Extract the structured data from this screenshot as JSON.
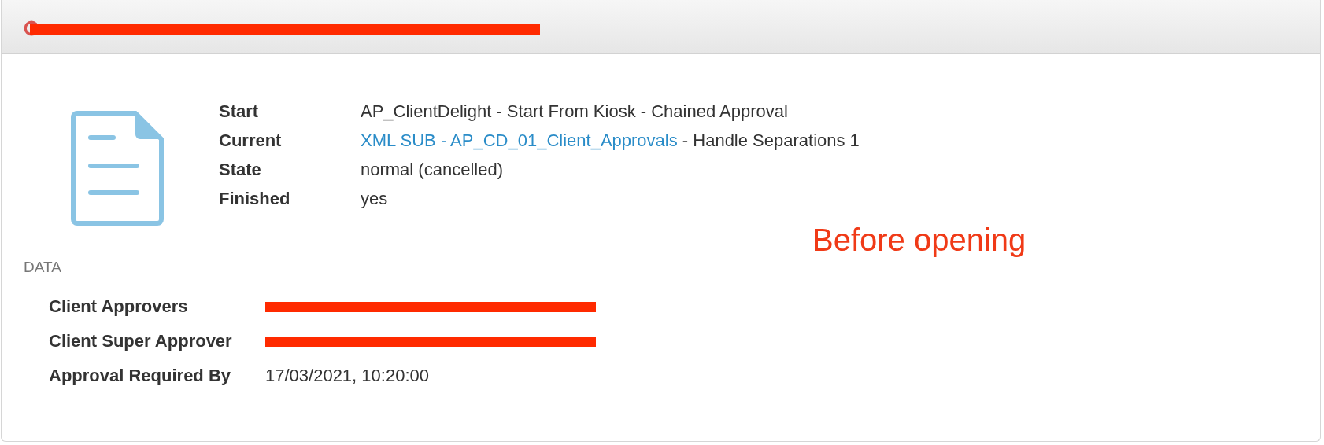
{
  "header": {
    "cancelled": true,
    "title_redacted": true
  },
  "summary": [
    {
      "label": "Start",
      "parts": [
        {
          "text": "AP_ClientDelight - Start From Kiosk - Chained Approval",
          "kind": "plain"
        }
      ]
    },
    {
      "label": "Current",
      "parts": [
        {
          "text": "XML SUB - AP_CD_01_Client_Approvals",
          "kind": "link"
        },
        {
          "text": " - Handle Separations 1",
          "kind": "plain"
        }
      ]
    },
    {
      "label": "State",
      "parts": [
        {
          "text": "normal (cancelled)",
          "kind": "plain"
        }
      ]
    },
    {
      "label": "Finished",
      "parts": [
        {
          "text": "yes",
          "kind": "plain"
        }
      ]
    }
  ],
  "annotation": "Before opening",
  "data": {
    "heading": "DATA",
    "fields": [
      {
        "label": "Client Approvers",
        "redacted": true
      },
      {
        "label": "Client Super Approver",
        "redacted": true
      },
      {
        "label": "Approval Required By",
        "value": "17/03/2021, 10:20:00",
        "redacted": false
      }
    ]
  }
}
